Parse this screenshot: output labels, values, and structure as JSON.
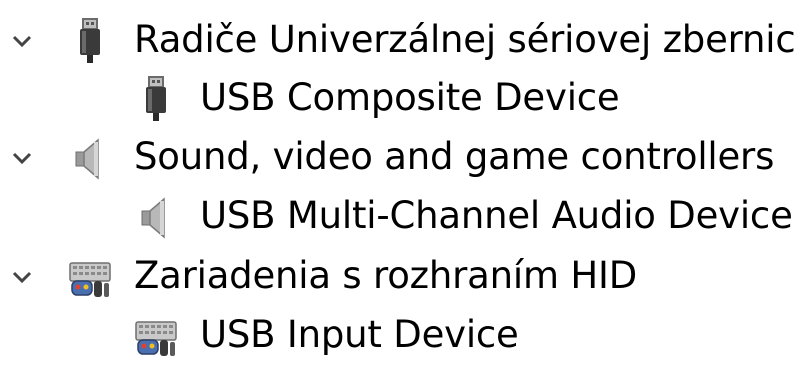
{
  "tree": {
    "groups": [
      {
        "label": "Radiče Univerzálnej sériovej zbernice",
        "icon": "usb-controller-icon",
        "expanded": true,
        "children": [
          {
            "label": "USB Composite Device",
            "icon": "usb-controller-icon"
          }
        ]
      },
      {
        "label": "Sound, video and game controllers",
        "icon": "speaker-icon",
        "expanded": true,
        "children": [
          {
            "label": "USB Multi-Channel Audio Device",
            "icon": "speaker-icon"
          }
        ]
      },
      {
        "label": "Zariadenia s rozhraním HID",
        "icon": "hid-keyboard-icon",
        "expanded": true,
        "children": [
          {
            "label": "USB Input Device",
            "icon": "hid-keyboard-icon"
          }
        ]
      }
    ]
  }
}
